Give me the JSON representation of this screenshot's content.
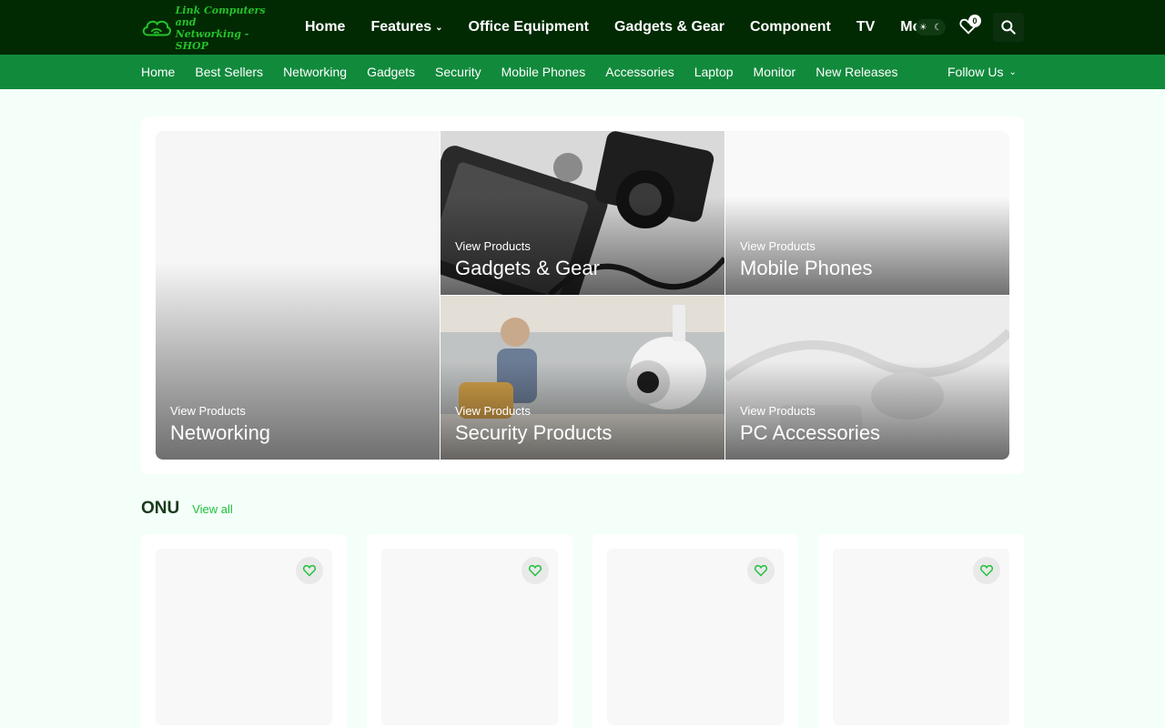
{
  "brand": {
    "logo_line1": "Link Computers and",
    "logo_line2": "Networking - SHOP"
  },
  "main_nav": [
    {
      "label": "Home",
      "dropdown": false
    },
    {
      "label": "Features",
      "dropdown": true
    },
    {
      "label": "Office Equipment",
      "dropdown": false
    },
    {
      "label": "Gadgets & Gear",
      "dropdown": false
    },
    {
      "label": "Component",
      "dropdown": false
    },
    {
      "label": "TV",
      "dropdown": false
    },
    {
      "label": "More",
      "dropdown": true
    }
  ],
  "header": {
    "wishlist_count": "0",
    "theme_icons": [
      "sun-icon",
      "moon-icon"
    ]
  },
  "sub_nav": [
    "Home",
    "Best Sellers",
    "Networking",
    "Gadgets",
    "Security",
    "Mobile Phones",
    "Accessories",
    "Laptop",
    "Monitor",
    "New Releases"
  ],
  "follow_label": "Follow Us",
  "featured": {
    "tiles": [
      {
        "kicker": "View Products",
        "title": "Networking"
      },
      {
        "kicker": "View Products",
        "title": "Gadgets & Gear"
      },
      {
        "kicker": "View Products",
        "title": "Mobile Phones"
      },
      {
        "kicker": "View Products",
        "title": "Security Products"
      },
      {
        "kicker": "View Products",
        "title": "PC Accessories"
      }
    ]
  },
  "section": {
    "title": "ONU",
    "view_all": "View all"
  },
  "colors": {
    "topbar": "#012a03",
    "subbar": "#118a3c",
    "accent": "#1fc23a",
    "page_bg": "#f4fff9"
  }
}
